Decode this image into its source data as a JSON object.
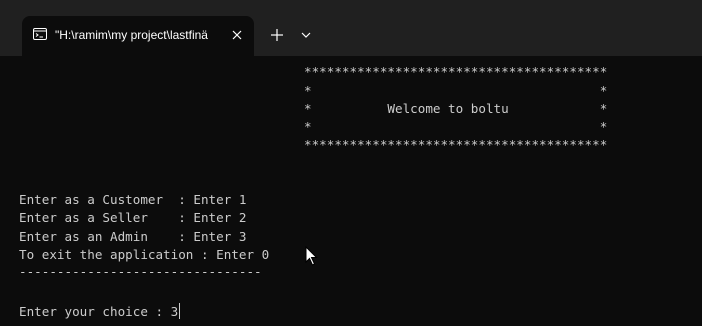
{
  "tab": {
    "title": "\"H:\\ramim\\my project\\lastfinä",
    "icon": "console-app-icon",
    "close_icon": "close-icon"
  },
  "tabbar": {
    "new_tab_icon": "plus-icon",
    "dropdown_icon": "chevron-down-icon"
  },
  "console": {
    "banner": [
      "****************************************",
      "*                                      *",
      "*          Welcome to boltu            *",
      "*                                      *",
      "****************************************"
    ],
    "menu": [
      "Enter as a Customer  : Enter 1",
      "Enter as a Seller    : Enter 2",
      "Enter as an Admin    : Enter 3",
      "To exit the application : Enter 0",
      "--------------------------------"
    ],
    "prompt": "Enter your choice : 3"
  },
  "colors": {
    "background": "#0c0c0c",
    "titlebar": "#202020",
    "text": "#cccccc"
  }
}
